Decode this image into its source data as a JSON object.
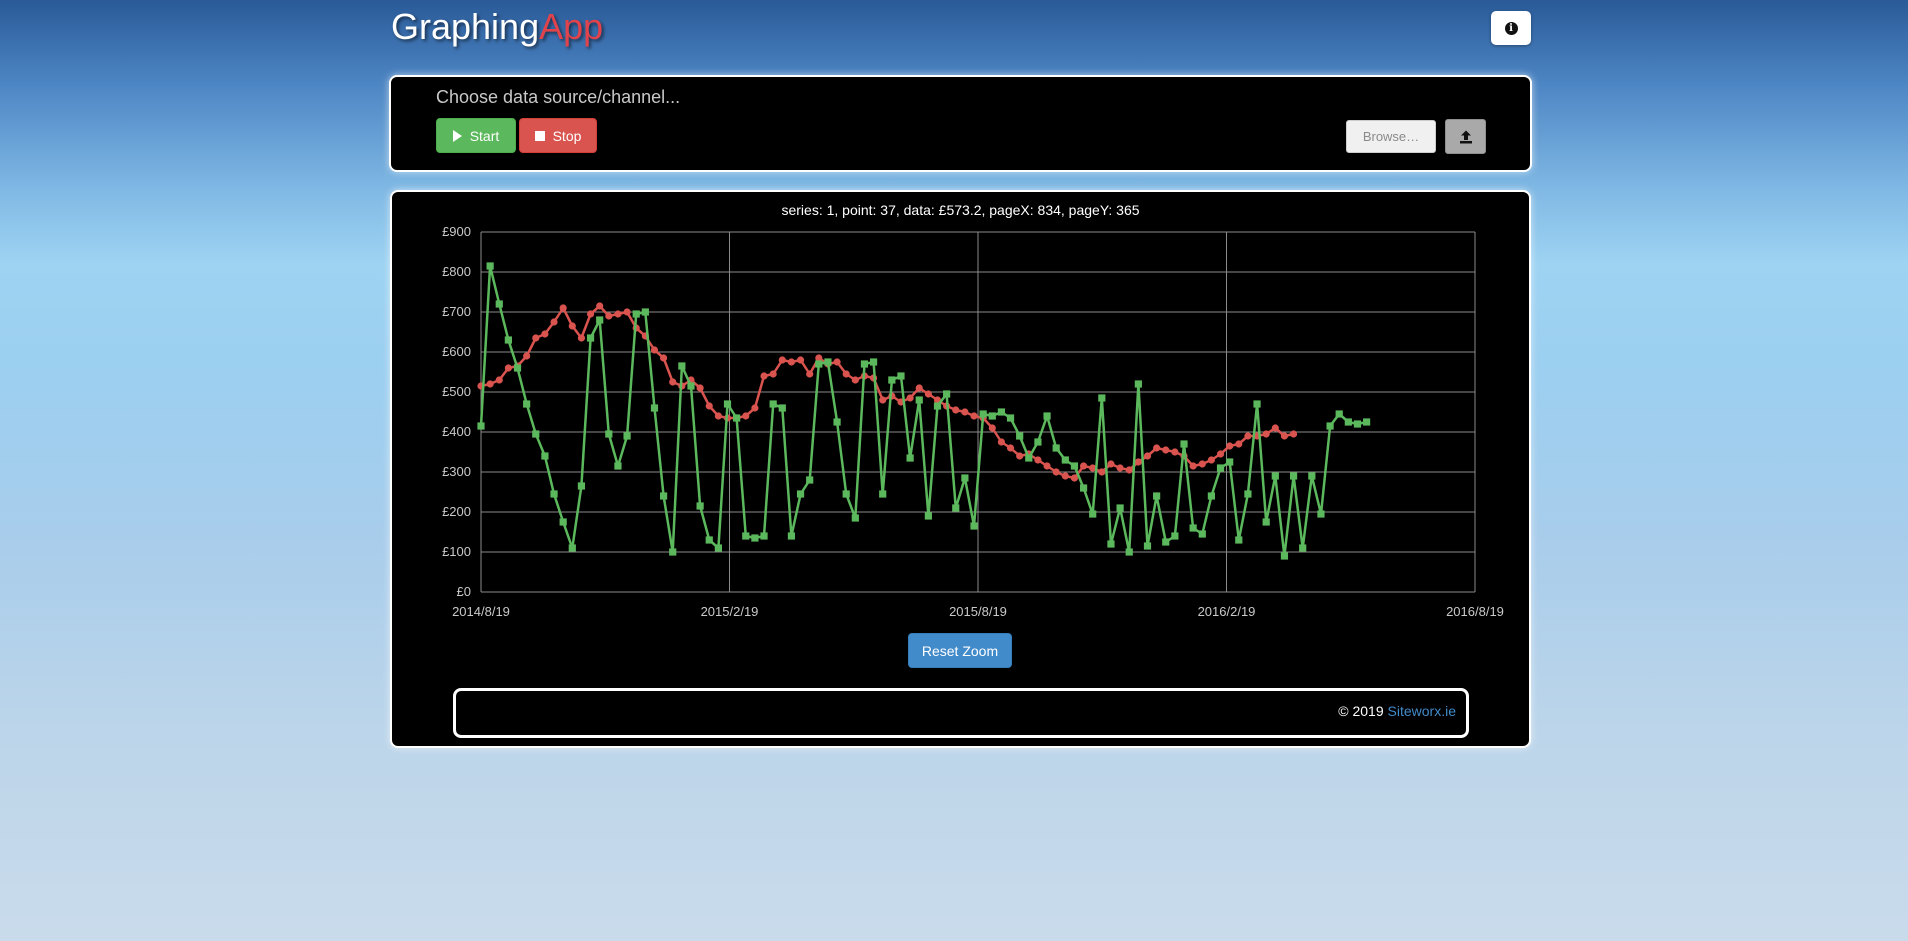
{
  "header": {
    "brand_part1": "Graphing",
    "brand_part2": "App",
    "info_icon": "info-circle-icon"
  },
  "controls": {
    "source_label": "Choose data source/channel...",
    "start_label": "Start",
    "stop_label": "Stop",
    "browse_label": "Browse…",
    "upload_icon": "upload-icon"
  },
  "chart": {
    "tooltip": "series: 1, point: 37, data: £573.2, pageX: 834, pageY: 365",
    "reset_label": "Reset Zoom"
  },
  "footer": {
    "copyright": "© 2019",
    "link_label": "Siteworx.ie"
  },
  "colors": {
    "series_red": "#d9534f",
    "series_green": "#5cb85c",
    "accent_blue": "#428bca"
  },
  "chart_data": {
    "type": "line",
    "title": "",
    "xlabel": "",
    "ylabel": "",
    "ylim": [
      0,
      900
    ],
    "yticks": [
      "£0",
      "£100",
      "£200",
      "£300",
      "£400",
      "£500",
      "£600",
      "£700",
      "£800",
      "£900"
    ],
    "xticks": [
      "2014/8/19",
      "2015/2/19",
      "2015/8/19",
      "2016/2/19",
      "2016/8/19"
    ],
    "grid": true,
    "series": [
      {
        "marker": "circle",
        "color": "#d9534f",
        "values": [
          515,
          520,
          530,
          560,
          565,
          590,
          635,
          645,
          675,
          710,
          665,
          635,
          695,
          715,
          690,
          695,
          700,
          660,
          640,
          605,
          585,
          525,
          515,
          530,
          510,
          465,
          440,
          435,
          435,
          440,
          460,
          540,
          545,
          580,
          575,
          580,
          545,
          585,
          570,
          575,
          545,
          530,
          540,
          535,
          480,
          490,
          475,
          485,
          510,
          495,
          480,
          465,
          455,
          450,
          440,
          435,
          410,
          375,
          360,
          340,
          345,
          330,
          315,
          300,
          290,
          285,
          315,
          310,
          300,
          320,
          310,
          305,
          325,
          340,
          360,
          355,
          350,
          340,
          315,
          320,
          330,
          345,
          365,
          370,
          390,
          390,
          395,
          410,
          390,
          395
        ]
      },
      {
        "marker": "square",
        "color": "#5cb85c",
        "values": [
          415,
          815,
          720,
          630,
          560,
          470,
          395,
          340,
          245,
          175,
          110,
          265,
          635,
          680,
          395,
          315,
          390,
          695,
          700,
          460,
          240,
          100,
          565,
          515,
          215,
          130,
          110,
          470,
          435,
          140,
          135,
          140,
          470,
          460,
          140,
          245,
          280,
          570,
          575,
          425,
          245,
          185,
          570,
          575,
          245,
          530,
          540,
          335,
          480,
          190,
          465,
          495,
          210,
          285,
          165,
          445,
          440,
          450,
          435,
          390,
          335,
          375,
          440,
          360,
          330,
          315,
          260,
          195,
          485,
          120,
          210,
          100,
          520,
          115,
          240,
          125,
          140,
          370,
          160,
          145,
          240,
          310,
          325,
          130,
          245,
          470,
          175,
          290,
          90,
          290,
          110,
          290,
          195,
          415,
          445,
          425,
          420,
          425
        ]
      }
    ]
  }
}
